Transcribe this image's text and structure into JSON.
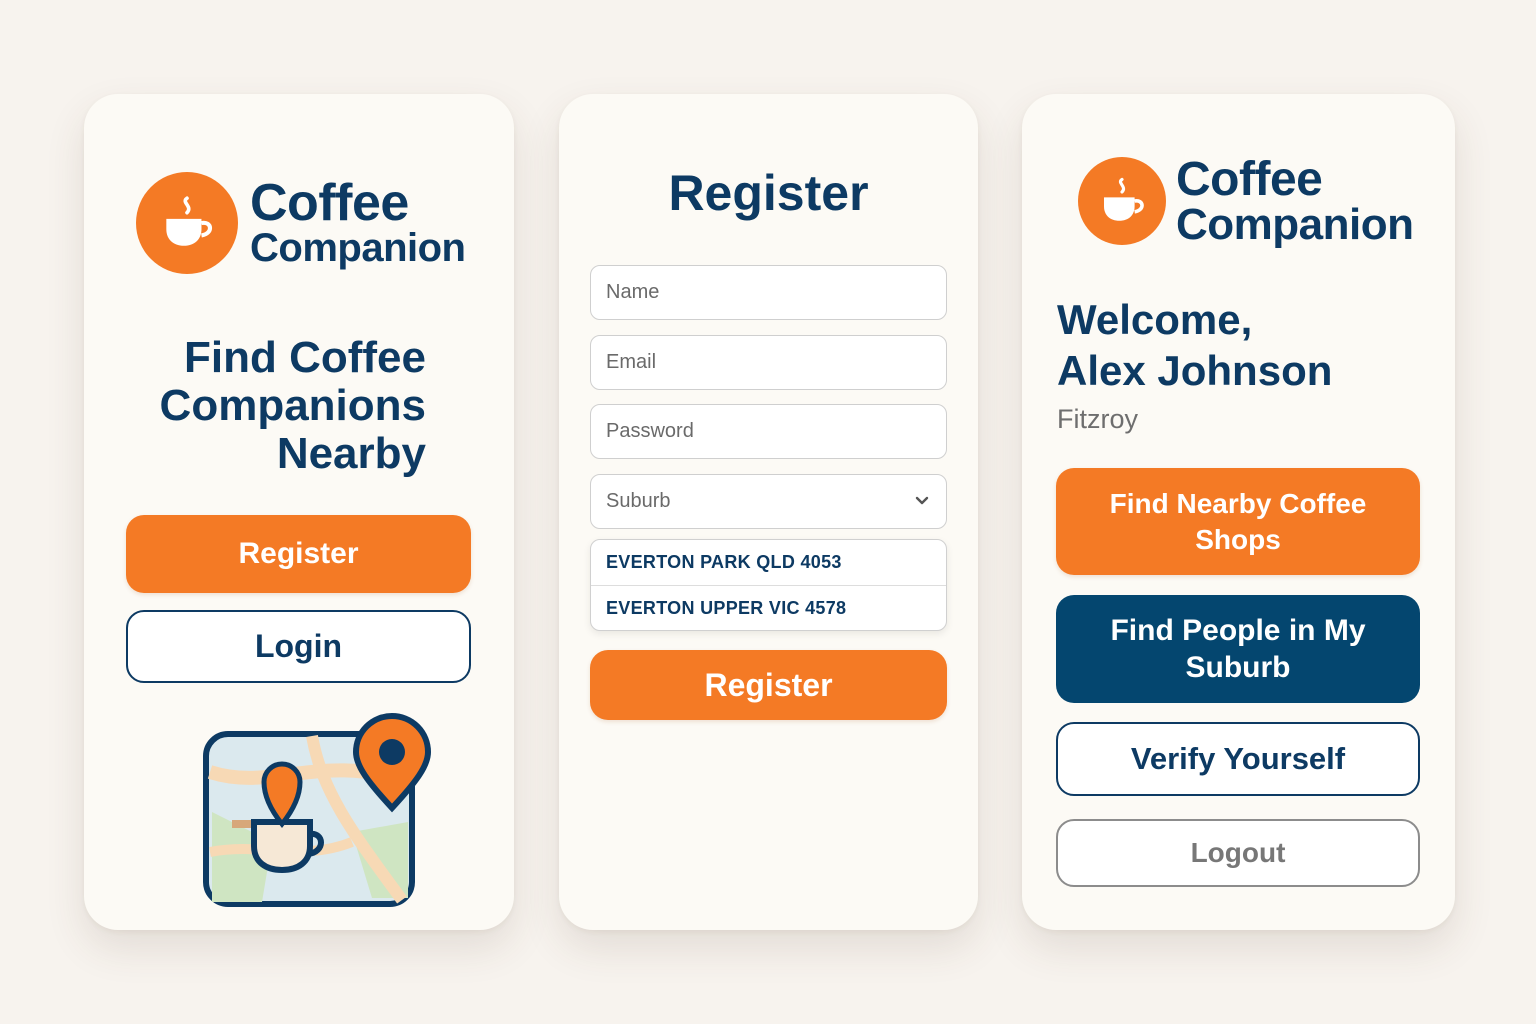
{
  "brand": {
    "name_line1": "Coffee",
    "name_line2": "Companion",
    "colors": {
      "orange": "#f47a25",
      "navy": "#0d3a63",
      "deep_blue": "#04466f"
    }
  },
  "landing": {
    "headline": [
      "Find Coffee",
      "Companions",
      "Nearby"
    ],
    "register_label": "Register",
    "login_label": "Login",
    "illustration": "map-with-coffee-pin-icon"
  },
  "register": {
    "title": "Register",
    "fields": {
      "name_placeholder": "Name",
      "email_placeholder": "Email",
      "password_placeholder": "Password",
      "suburb_placeholder": "Suburb"
    },
    "suburb_options": [
      "EVERTON PARK QLD 4053",
      "EVERTON UPPER VIC 4578"
    ],
    "submit_label": "Register"
  },
  "home": {
    "welcome_line1": "Welcome,",
    "user_name": "Alex Johnson",
    "suburb": "Fitzroy",
    "find_shops_label": "Find Nearby Coffee Shops",
    "find_people_label": "Find People in My Suburb",
    "verify_label": "Verify Yourself",
    "logout_label": "Logout"
  }
}
